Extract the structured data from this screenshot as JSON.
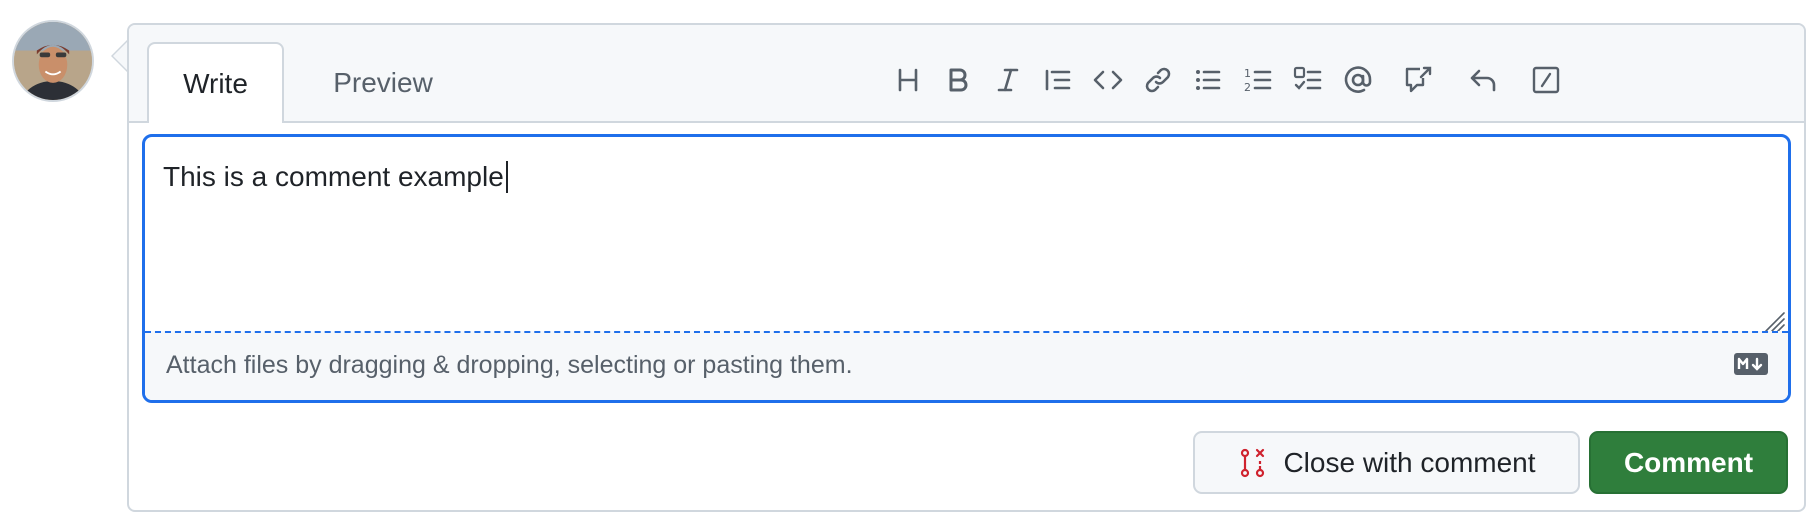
{
  "avatar": {
    "icon": "user-avatar"
  },
  "tabs": [
    {
      "label": "Write",
      "active": true
    },
    {
      "label": "Preview",
      "active": false
    }
  ],
  "toolbar": [
    {
      "icon": "heading-icon"
    },
    {
      "icon": "bold-icon"
    },
    {
      "icon": "italic-icon"
    },
    {
      "icon": "quote-icon"
    },
    {
      "icon": "code-icon"
    },
    {
      "icon": "link-icon"
    },
    {
      "icon": "unordered-list-icon"
    },
    {
      "icon": "ordered-list-icon"
    },
    {
      "icon": "task-list-icon"
    },
    {
      "icon": "mention-icon"
    },
    {
      "icon": "cross-reference-icon"
    },
    {
      "icon": "reply-icon"
    },
    {
      "icon": "slash-commands-icon"
    }
  ],
  "editor": {
    "value": "This is a comment example",
    "attach_hint": "Attach files by dragging & dropping, selecting or pasting them.",
    "markdown_icon": "markdown-icon"
  },
  "actions": {
    "close_label": "Close with comment",
    "close_icon": "issue-closed-icon",
    "comment_label": "Comment"
  },
  "colors": {
    "focus": "#1f6feb",
    "primary_button": "#2f7e3c",
    "close_icon": "#cf222e"
  }
}
